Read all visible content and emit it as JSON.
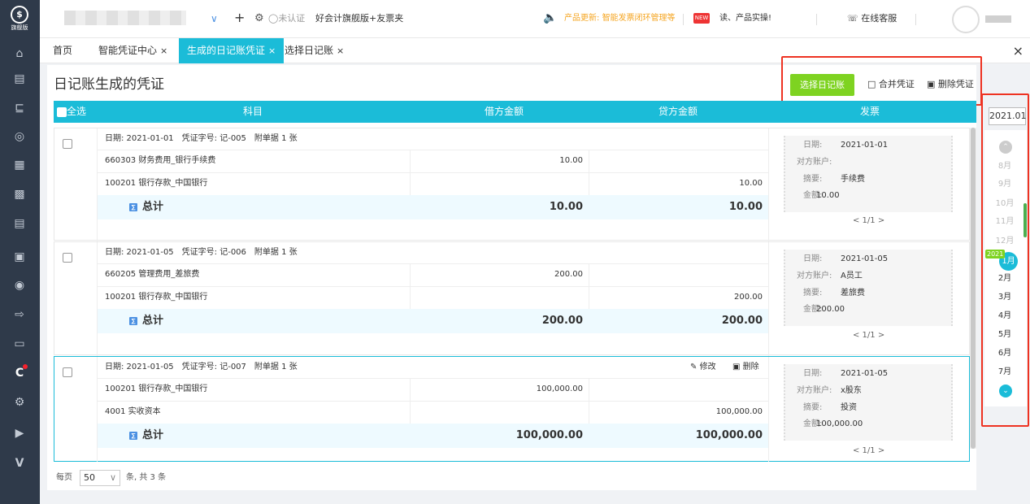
{
  "logo": {
    "text": "旗舰版"
  },
  "sidebar": {
    "icons": [
      "home-icon",
      "receipt-icon",
      "chart-icon",
      "money-bag-icon",
      "ledger-icon",
      "invoice-icon",
      "printer-icon",
      "report-icon",
      "coins-icon",
      "export-icon",
      "folder-icon",
      "c-badge-icon",
      "settings-icon",
      "play-box-icon",
      "v-logo-icon"
    ]
  },
  "topbar": {
    "cert_status": "未认证",
    "product": "好会计旗舰版+友票夹",
    "update_prefix": "产品更新:",
    "update_text": "智能发票闭环管理等",
    "promo": "读、产品实操!",
    "service": "在线客服"
  },
  "tabs": [
    {
      "label": "首页",
      "closable": false
    },
    {
      "label": "智能凭证中心",
      "closable": true
    },
    {
      "label": "生成的日记账凭证",
      "closable": true,
      "active": true
    },
    {
      "label": "选择日记账",
      "closable": true
    }
  ],
  "page": {
    "title": "日记账生成的凭证",
    "select_journal": "选择日记账",
    "merge": "合并凭证",
    "delete": "删除凭证"
  },
  "table": {
    "headers": {
      "select_all": "全选",
      "subject": "科目",
      "debit": "借方金额",
      "credit": "贷方金额",
      "invoice": "发票"
    },
    "total_label": "总计",
    "edit": "修改",
    "del": "删除"
  },
  "vouchers": [
    {
      "header": "日期: 2021-01-01　凭证字号: 记-005　附单据 1 张",
      "lines": [
        {
          "subject": "660303 财务费用_银行手续费",
          "debit": "10.00",
          "credit": ""
        },
        {
          "subject": "100201 银行存款_中国银行",
          "debit": "",
          "credit": "10.00"
        }
      ],
      "total_debit": "10.00",
      "total_credit": "10.00",
      "invoice": {
        "date_label": "日期:",
        "date": "2021-01-01",
        "acct_label": "对方账户:",
        "acct": "",
        "memo_label": "摘要:",
        "memo": "手续费",
        "amt_label": "金额:",
        "amt": "10.00",
        "pager": "< 1/1 >"
      }
    },
    {
      "header": "日期: 2021-01-05　凭证字号: 记-006　附单据 1 张",
      "lines": [
        {
          "subject": "660205 管理费用_差旅费",
          "debit": "200.00",
          "credit": ""
        },
        {
          "subject": "100201 银行存款_中国银行",
          "debit": "",
          "credit": "200.00"
        }
      ],
      "total_debit": "200.00",
      "total_credit": "200.00",
      "invoice": {
        "date_label": "日期:",
        "date": "2021-01-05",
        "acct_label": "对方账户:",
        "acct": "A员工",
        "memo_label": "摘要:",
        "memo": "差旅费",
        "amt_label": "金额:",
        "amt": "200.00",
        "pager": "< 1/1 >"
      }
    },
    {
      "header": "日期: 2021-01-05　凭证字号: 记-007　附单据 1 张",
      "lines": [
        {
          "subject": "100201 银行存款_中国银行",
          "debit": "100,000.00",
          "credit": ""
        },
        {
          "subject": "4001 实收资本",
          "debit": "",
          "credit": "100,000.00"
        }
      ],
      "total_debit": "100,000.00",
      "total_credit": "100,000.00",
      "invoice": {
        "date_label": "日期:",
        "date": "2021-01-05",
        "acct_label": "对方账户:",
        "acct": "x股东",
        "memo_label": "摘要:",
        "memo": "投资",
        "amt_label": "金额:",
        "amt": "100,000.00",
        "pager": "< 1/1 >"
      }
    }
  ],
  "footer": {
    "per_page": "每页",
    "page_size": "50",
    "suffix": "条, 共 3 条"
  },
  "period_picker": {
    "current": "2021.01",
    "months_before": [
      "8月",
      "9月",
      "10月",
      "11月",
      "12月"
    ],
    "year_badge": "2021",
    "current_month": "1月",
    "months_after": [
      "2月",
      "3月",
      "4月",
      "5月",
      "6月",
      "7月"
    ]
  },
  "colors": {
    "accent": "#1bbcd8",
    "green": "#7ed321",
    "sidebar": "#2f3a4a",
    "highlight_border": "#e32222"
  }
}
